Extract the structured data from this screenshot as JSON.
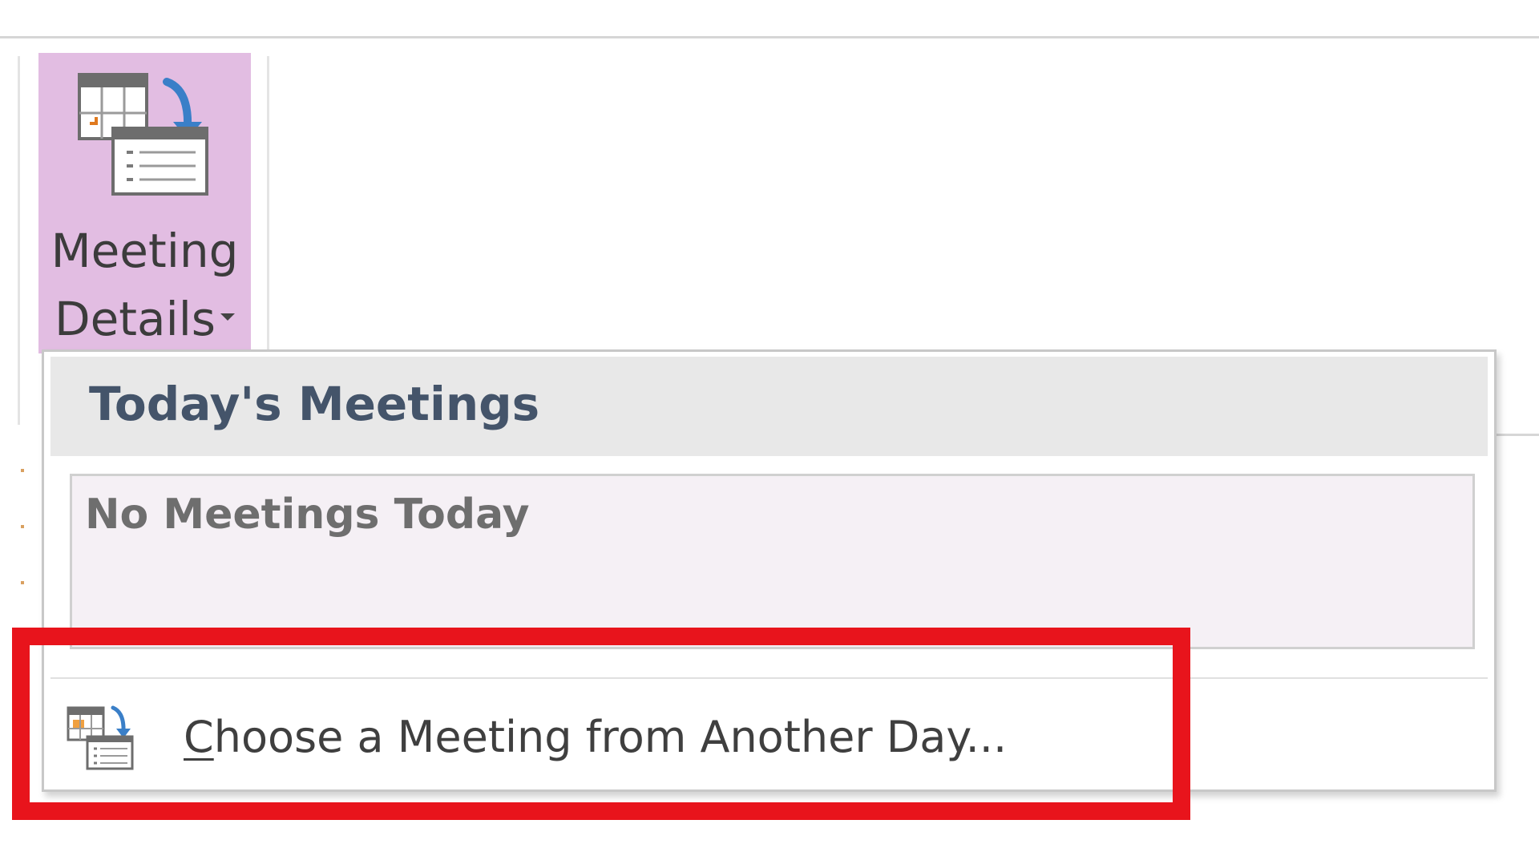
{
  "ribbon": {
    "meeting_details": {
      "label_line1": "Meeting",
      "label_line2": "Details",
      "icon": "meeting-details-icon",
      "highlight_color": "#e2bde2"
    }
  },
  "dropdown": {
    "header_title": "Today's Meetings",
    "empty_message": "No Meetings Today",
    "menu_item": {
      "label_underlined": "C",
      "label_rest": "hoose a Meeting from Another Day...",
      "icon": "calendar-arrow-icon"
    }
  },
  "annotation": {
    "color": "#e8141c"
  }
}
